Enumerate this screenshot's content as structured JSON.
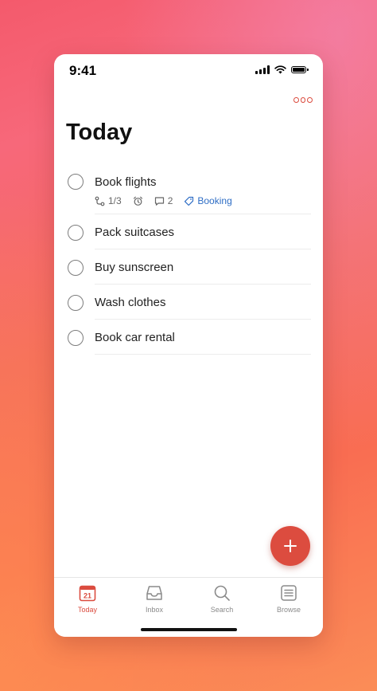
{
  "status_bar": {
    "time": "9:41"
  },
  "header": {
    "title": "Today",
    "more_icon": "more-horizontal-icon"
  },
  "tasks": [
    {
      "title": "Book flights",
      "subtasks": "1/3",
      "reminder_icon": "alarm-icon",
      "comments": "2",
      "label": "Booking"
    },
    {
      "title": "Pack suitcases"
    },
    {
      "title": "Buy sunscreen"
    },
    {
      "title": "Wash clothes"
    },
    {
      "title": "Book car rental"
    }
  ],
  "fab": {
    "icon": "plus-icon"
  },
  "tab_bar": {
    "today": {
      "label": "Today",
      "date": "21"
    },
    "inbox": {
      "label": "Inbox"
    },
    "search": {
      "label": "Search"
    },
    "browse": {
      "label": "Browse"
    }
  },
  "colors": {
    "accent": "#dc4c3f",
    "label": "#2f6ec5",
    "inactive_tab": "#8a8a8a"
  }
}
